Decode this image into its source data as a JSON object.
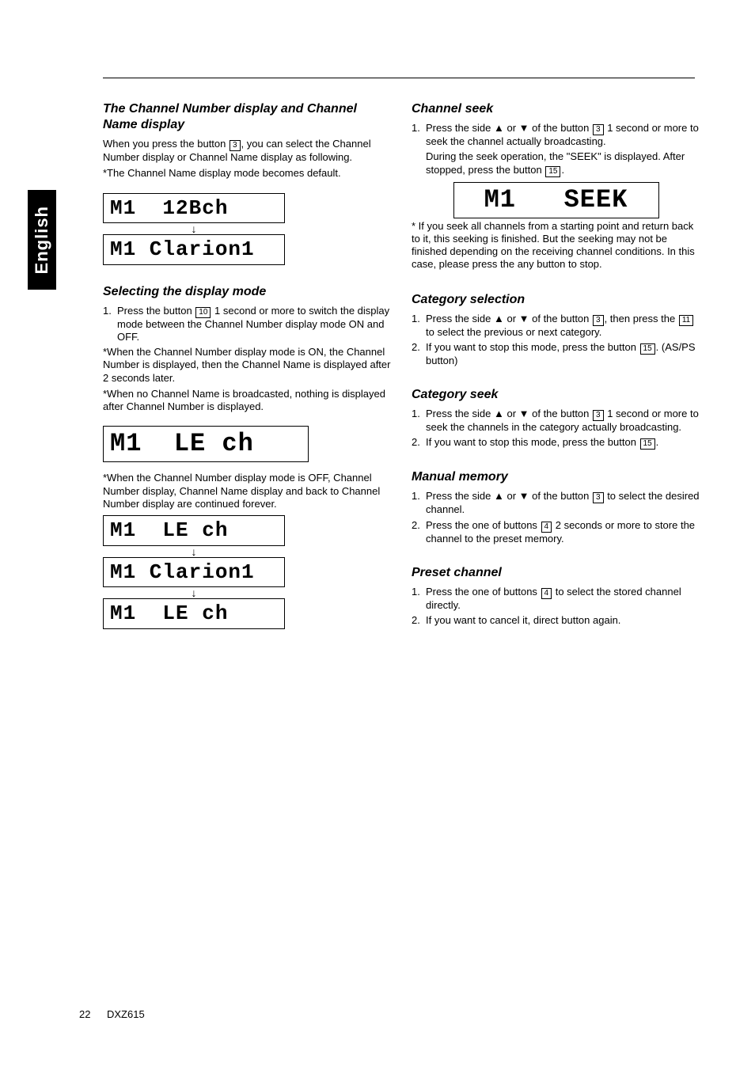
{
  "sidebar_label": "English",
  "page_number": "22",
  "footer_model": "DXZ615",
  "left": {
    "s1": {
      "title": "The Channel Number display and Channel Name display",
      "p1a": "When you press the button ",
      "key1": "3",
      "p1b": ", you can select the Channel Number display or Channel Name display as following.",
      "note": "*The Channel Name display mode becomes default.",
      "lcd1": "M1  12Bch",
      "lcd2": "M1 Clarion1"
    },
    "s2": {
      "title": "Selecting the display mode",
      "step1a": "Press the button ",
      "step1key": "10",
      "step1b": " 1 second or more to switch the display mode between the Channel Number display mode ON and OFF.",
      "p1": "*When the Channel Number display mode is ON, the Channel Number is displayed, then the Channel Name is displayed after 2 seconds later.",
      "p2": "*When no Channel Name is broadcasted, nothing is displayed after Channel Number is displayed.",
      "lcd1": "M1  LE ch"
    },
    "s3": {
      "p1": "*When the Channel Number display mode is OFF, Channel Number display, Channel Name display and back to Channel Number display are continued forever.",
      "lcd1": "M1  LE ch",
      "lcd2": "M1 Clarion1",
      "lcd3": "M1  LE ch"
    }
  },
  "right": {
    "s1": {
      "title": "Channel seek",
      "step1a": "Press the side  ▲ or ▼  of the button ",
      "step1key": "3",
      "step1b": " 1 second or more to seek the channel actually broadcasting.",
      "p1a": "During the seek operation, the \"SEEK\" is displayed. After stopped, press the button ",
      "p1key": "15",
      "p1b": ".",
      "lcd1": "M1   SEEK",
      "p2": "* If you seek all channels from a starting point and return back to it, this seeking is finished.  But the seeking may not be finished depending on the receiving channel conditions. In this case, please press the any button to stop."
    },
    "s2": {
      "title": "Category selection",
      "step1a": "Press the side  ▲ or ▼  of the button ",
      "step1key": "3",
      "step1b": ", then press the ",
      "step1key2": "11",
      "step1c": " to select the previous or next category.",
      "step2a": "If you want to stop this mode, press the button ",
      "step2key": "15",
      "step2b": ". (AS/PS button)"
    },
    "s3": {
      "title": "Category seek",
      "step1a": "Press the side ▲ or ▼ of the button ",
      "step1key": "3",
      "step1b": " 1 second or more to seek the channels in the category actually broadcasting.",
      "step2a": "If you want to stop this mode, press the button ",
      "step2key": "15",
      "step2b": "."
    },
    "s4": {
      "title": "Manual memory",
      "step1a": "Press the side ▲ or ▼ of the button ",
      "step1key": "3",
      "step1b": " to select the desired channel.",
      "step2a": "Press the one of buttons ",
      "step2key": "4",
      "step2b": " 2 seconds or more to store the channel to the preset memory."
    },
    "s5": {
      "title": "Preset channel",
      "step1a": "Press the one of buttons ",
      "step1key": "4",
      "step1b": " to select the stored channel directly.",
      "step2": "If you want to cancel it, direct button again."
    }
  }
}
